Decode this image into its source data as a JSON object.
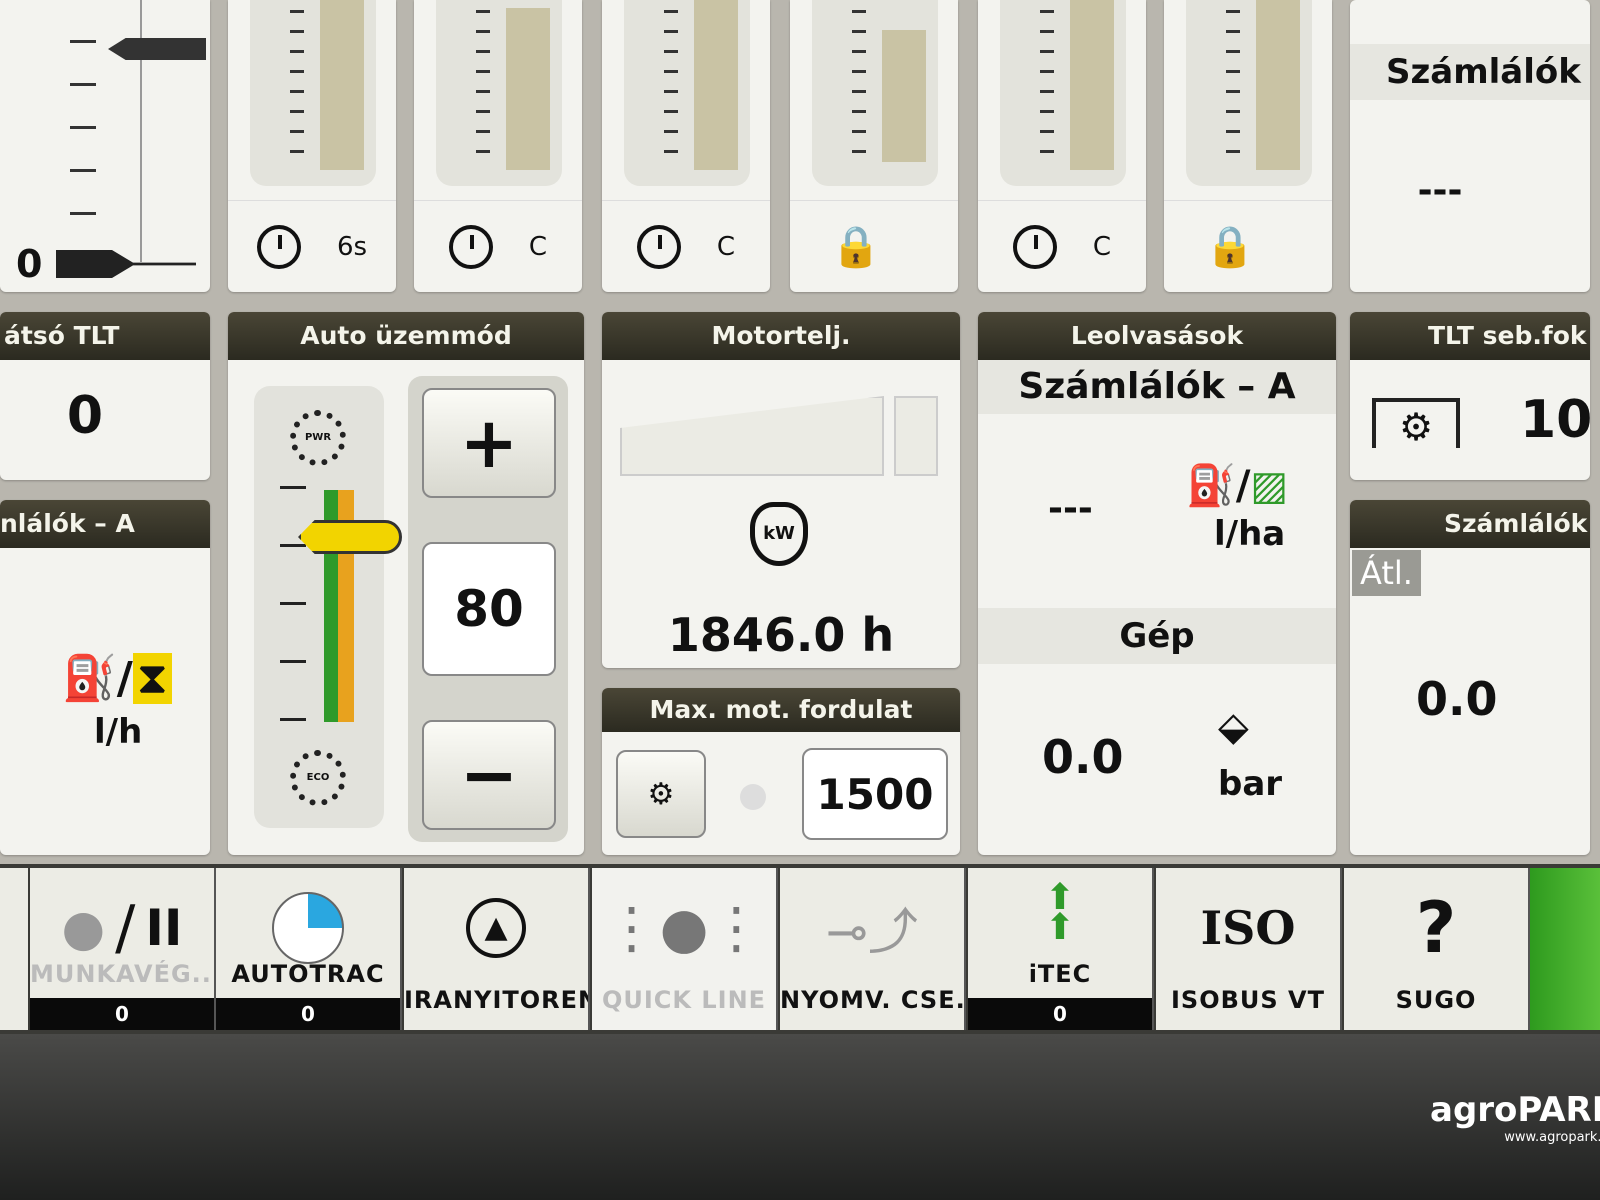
{
  "top_left_gauge": {
    "zero_label": "0"
  },
  "top_sliders": [
    {
      "footer_icon": "clock-icon",
      "footer_text": "6s"
    },
    {
      "footer_icon": "clock-icon",
      "footer_text": "C"
    },
    {
      "footer_icon": "clock-icon",
      "footer_text": "C"
    },
    {
      "footer_icon": "lock-icon",
      "footer_text": ""
    },
    {
      "footer_icon": "clock-icon",
      "footer_text": "C"
    },
    {
      "footer_icon": "lock-icon",
      "footer_text": ""
    }
  ],
  "top_right": {
    "title": "Számlálók",
    "value": "---"
  },
  "rear_pto": {
    "title": "átsó TLT",
    "value": "0"
  },
  "counters_left": {
    "title": "nlálók – A",
    "unit": "l/h"
  },
  "auto_mode": {
    "title": "Auto üzemmód",
    "pwr_label": "PWR",
    "eco_label": "ECO",
    "plus": "+",
    "value": "80",
    "minus": "−"
  },
  "engine_power": {
    "title": "Motortelj.",
    "kw_label": "kW",
    "hours": "1846.0 h"
  },
  "max_rpm": {
    "title": "Max. mot. fordulat",
    "value": "1500"
  },
  "readings": {
    "title": "Leolvasások",
    "subtitle": "Számlálók – A",
    "value1": "---",
    "unit1": "l/ha",
    "section": "Gép",
    "value2": "0.0",
    "unit2": "bar"
  },
  "pto_speed": {
    "title": "TLT seb.fok",
    "value": "10"
  },
  "counters_right": {
    "title": "Számlálók",
    "badge": "Átl.",
    "value": "0.0"
  },
  "taskbar": [
    {
      "label": "MUNKAVÉG...",
      "count": "0",
      "icon": "record-pause-icon"
    },
    {
      "label": "AUTOTRAC",
      "count": "0",
      "icon": "autotrac-icon"
    },
    {
      "label": "IRANYITOREND",
      "icon": "guidance-icon"
    },
    {
      "label": "QUICK LINE",
      "icon": "quick-line-icon"
    },
    {
      "label": "NYOMV. CSE...",
      "icon": "track-switch-icon"
    },
    {
      "label": "iTEC",
      "count": "0",
      "icon": "itec-icon"
    },
    {
      "label": "ISOBUS VT",
      "icon": "iso-icon"
    },
    {
      "label": "SUGO",
      "icon": "help-icon"
    }
  ],
  "watermark": {
    "brand": "agroPARK",
    "url": "www.agropark.hu"
  },
  "colors": {
    "header": "#2f2d22",
    "accent_green": "#2f9a2a",
    "accent_orange": "#e8a21e",
    "autotrac_blue": "#2aa7e0",
    "bar_fill": "#c9c3a4"
  }
}
